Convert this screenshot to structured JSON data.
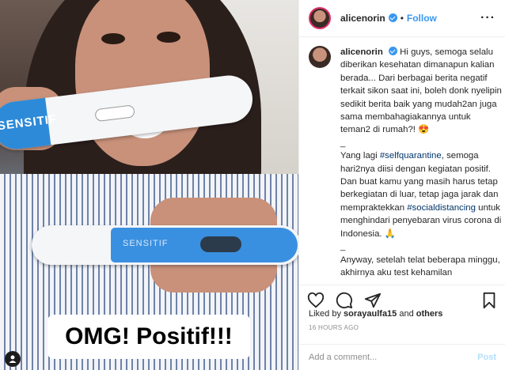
{
  "media": {
    "overlay_caption": "OMG! Positif!!!",
    "test_brand_top": "SENSITIF",
    "test_brand_bottom": "SENSITIF",
    "user_tag_icon": "person-icon"
  },
  "header": {
    "username": "alicenorin",
    "separator": "•",
    "follow_label": "Follow",
    "more_icon": "ellipsis-icon"
  },
  "caption": {
    "username": "alicenorin",
    "p1": "Hi guys, semoga selalu diberikan kesehatan dimanapun kalian berada... Dari berbagai berita negatif terkait sikon saat ini, boleh donk nyelipin sedikit berita baik yang mudah2an juga sama membahagiakannya untuk teman2 di rumah?! 😍",
    "sep1": "_",
    "p2_a": "Yang lagi ",
    "p2_tag1": "#selfquarantine",
    "p2_b": ", semoga hari2nya diisi dengan kegiatan positif. Dan buat kamu yang masih harus tetap berkegiatan di luar, tetap jaga jarak dan mempraktekkan ",
    "p2_tag2": "#socialdistancing",
    "p2_c": " untuk menghindari penyebaran virus corona di Indonesia. 🙏",
    "sep2": "_",
    "p3": "Anyway, setelah telat beberapa minggu, akhirnya aku test kehamilan"
  },
  "actions": {
    "like_icon": "heart-icon",
    "comment_icon": "comment-icon",
    "share_icon": "share-icon",
    "save_icon": "bookmark-icon"
  },
  "likes": {
    "prefix": "Liked by ",
    "user": "sorayaulfa15",
    "and": " and ",
    "others": "others"
  },
  "timestamp": "16 HOURS AGO",
  "comment_box": {
    "placeholder": "Add a comment...",
    "post_label": "Post"
  }
}
